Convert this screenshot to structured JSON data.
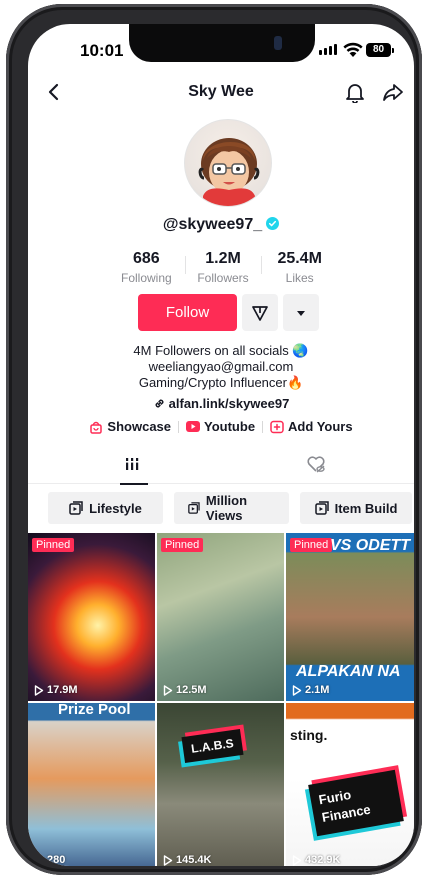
{
  "status_bar": {
    "time": "10:01",
    "battery": "80"
  },
  "header": {
    "title": "Sky Wee"
  },
  "profile": {
    "username": "@skywee97_",
    "stats": [
      {
        "value": "686",
        "label": "Following"
      },
      {
        "value": "1.2M",
        "label": "Followers"
      },
      {
        "value": "25.4M",
        "label": "Likes"
      }
    ],
    "follow_label": "Follow",
    "bio_lines": [
      "4M Followers on all socials 🌏",
      "weeliangyao@gmail.com",
      "Gaming/Crypto Influencer🔥"
    ],
    "link": "alfan.link/skywee97",
    "chips": [
      {
        "label": "Showcase",
        "icon": "shop-bag-icon"
      },
      {
        "label": "Youtube",
        "icon": "youtube-icon"
      },
      {
        "label": "Add Yours",
        "icon": "add-yours-icon"
      }
    ]
  },
  "tabs": [
    {
      "name": "videos",
      "icon": "grid-bars-icon",
      "active": true
    },
    {
      "name": "liked",
      "icon": "hidden-heart-icon",
      "active": false
    }
  ],
  "playlists": [
    "Lifestyle",
    "Million Views",
    "Item Build"
  ],
  "videos": [
    {
      "pinned": true,
      "pinned_label": "Pinned",
      "views": "17.9M"
    },
    {
      "pinned": true,
      "pinned_label": "Pinned",
      "views": "12.5M"
    },
    {
      "pinned": true,
      "pinned_label": "Pinned",
      "views": "2.1M",
      "overlay_top": "VS ODETT",
      "overlay_bottom": "ALPAKAN NA"
    },
    {
      "pinned": false,
      "views": "280",
      "overlay_top": "Prize Pool"
    },
    {
      "pinned": false,
      "views": "145.4K",
      "overlay_top": "L.A.B.S"
    },
    {
      "pinned": false,
      "views": "432.9K",
      "overlay_top": "sting.",
      "overlay_bottom": "Furio Finance"
    }
  ],
  "colors": {
    "accent": "#fe2c55",
    "text": "#161823",
    "muted": "#8a8b91",
    "verified": "#20d5ec"
  }
}
